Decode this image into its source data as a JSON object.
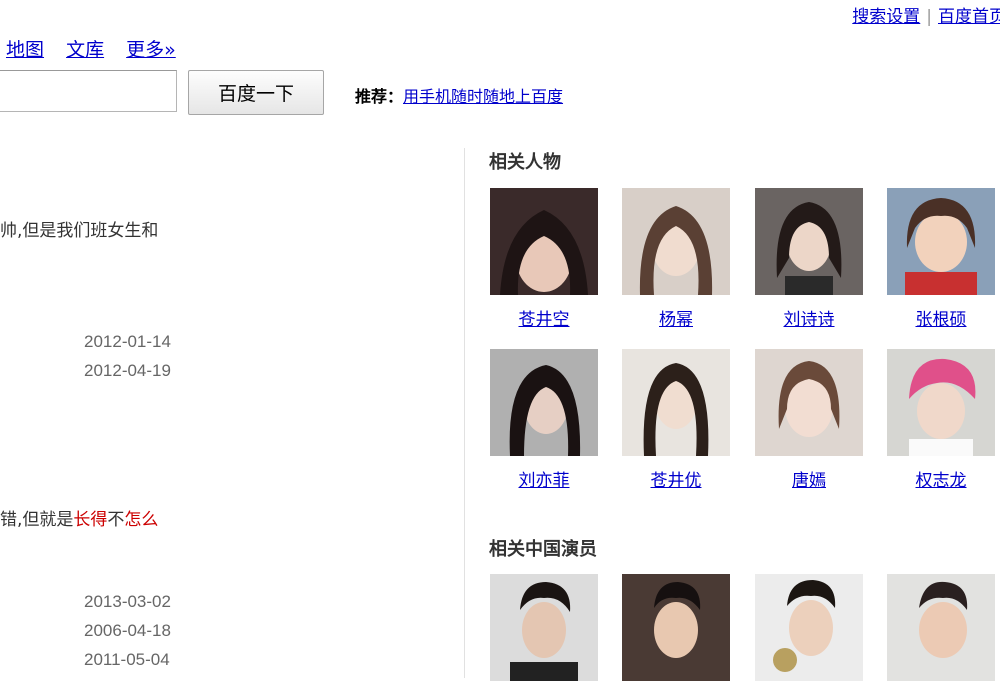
{
  "top_links": [
    "搜索设置",
    "|",
    "百度首页"
  ],
  "nav_links": [
    "地图",
    "文库",
    "更多»"
  ],
  "search": {
    "value": "",
    "button_label": "百度一下"
  },
  "recommend": {
    "label": "推荐：",
    "link": "用手机随时随地上百度"
  },
  "results": [
    {
      "snippet": "帅,但是我们班女生和",
      "dates": [
        "2012-01-14",
        "2012-04-19"
      ]
    },
    {
      "snippet_parts": [
        "错,但就是",
        "长得",
        "不",
        "怎么"
      ],
      "dates": [
        "2013-03-02",
        "2006-04-18",
        "2011-05-04"
      ]
    }
  ],
  "related_people": {
    "title": "相关人物",
    "people": [
      "苍井空",
      "杨幂",
      "刘诗诗",
      "张根硕",
      "刘亦菲",
      "苍井优",
      "唐嫣",
      "权志龙"
    ]
  },
  "related_actors": {
    "title": "相关中国演员"
  },
  "colors": {
    "link": "#0000cc",
    "highlight": "#cc0000"
  }
}
